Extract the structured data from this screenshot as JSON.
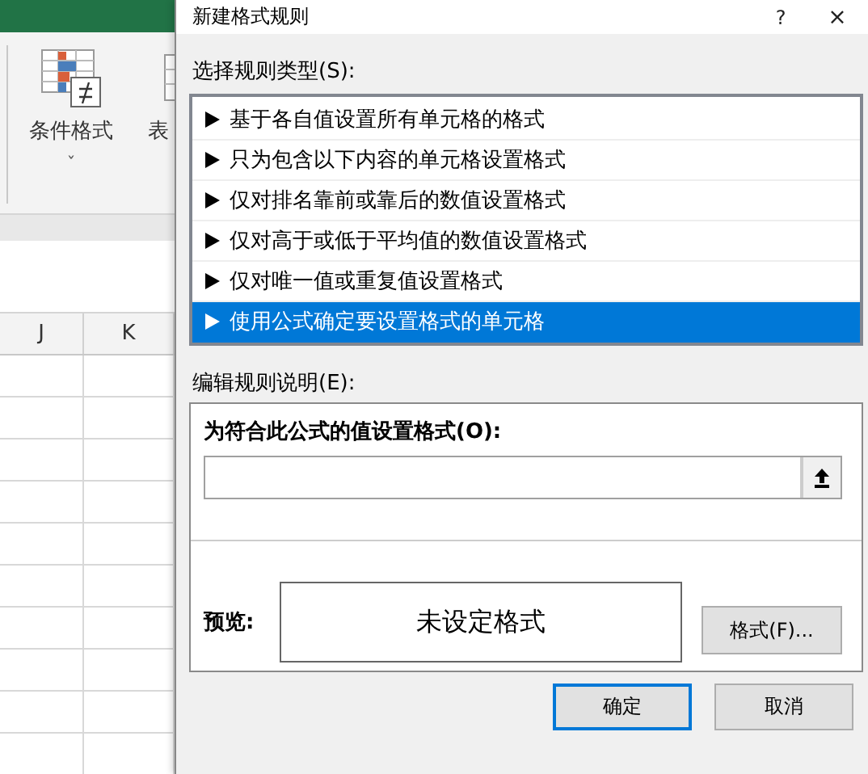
{
  "background_app": {
    "ribbon": [
      {
        "label": "条件格式",
        "dropdown": "ˇ"
      },
      {
        "label": "表"
      }
    ],
    "columns": [
      "J",
      "K"
    ]
  },
  "dialog": {
    "title": "新建格式规则",
    "help": "?",
    "close": "×",
    "rule_type_label": "选择规则类型(S):",
    "rule_types": [
      {
        "label": "基于各自值设置所有单元格的格式",
        "selected": false
      },
      {
        "label": "只为包含以下内容的单元格设置格式",
        "selected": false
      },
      {
        "label": "仅对排名靠前或靠后的数值设置格式",
        "selected": false
      },
      {
        "label": "仅对高于或低于平均值的数值设置格式",
        "selected": false
      },
      {
        "label": "仅对唯一值或重复值设置格式",
        "selected": false
      },
      {
        "label": "使用公式确定要设置格式的单元格",
        "selected": true
      }
    ],
    "description_label": "编辑规则说明(E):",
    "formula_label": "为符合此公式的值设置格式(O):",
    "preview_label": "预览:",
    "preview_text": "未设定格式",
    "format_button": "格式(F)...",
    "buttons": [
      {
        "label": "确定",
        "default": true
      },
      {
        "label": "取消",
        "default": false
      }
    ]
  }
}
